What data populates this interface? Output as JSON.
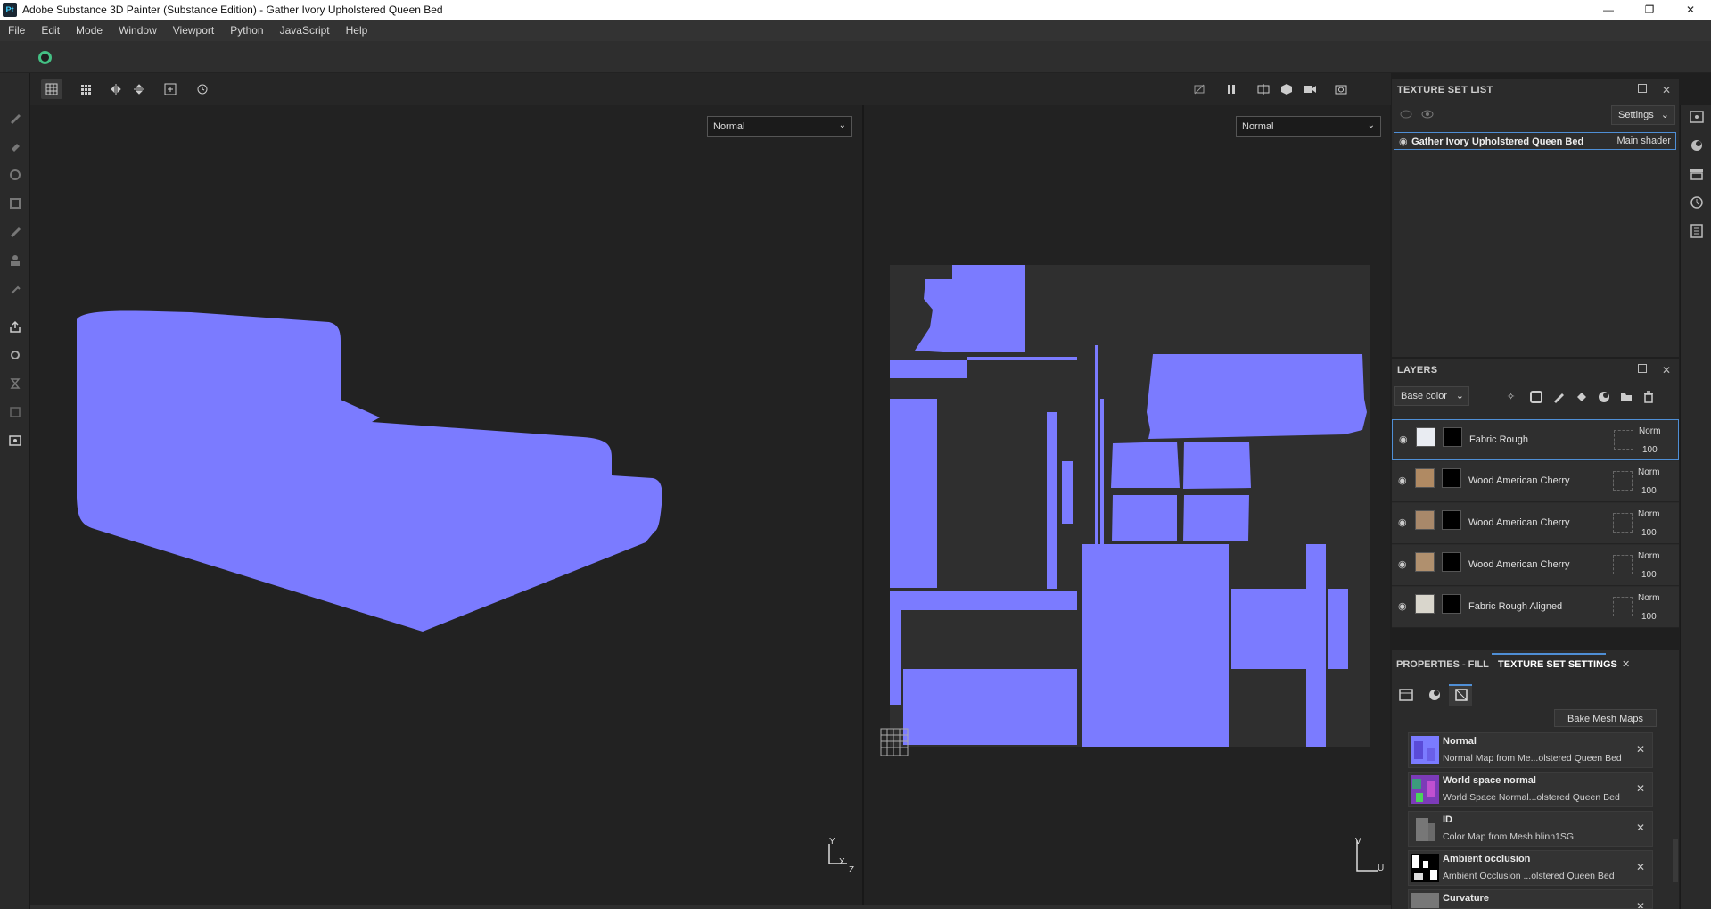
{
  "window": {
    "app_icon": "Pt",
    "title": "Adobe Substance 3D Painter (Substance Edition) - Gather Ivory Upholstered Queen Bed",
    "minimize": "—",
    "restore": "❐",
    "close": "✕"
  },
  "menu": [
    "File",
    "Edit",
    "Mode",
    "Window",
    "Viewport",
    "Python",
    "JavaScript",
    "Help"
  ],
  "viewport": {
    "left_mode": "Normal",
    "right_mode": "Normal",
    "axis_3d": {
      "y": "Y",
      "x": "X",
      "z": "Z"
    },
    "axis_2d": {
      "v": "V",
      "u": "U"
    },
    "uv_color": "#7b7bff"
  },
  "texture_set_list": {
    "title": "TEXTURE SET LIST",
    "settings_label": "Settings",
    "set_name": "Gather Ivory Upholstered Queen Bed",
    "shader": "Main shader"
  },
  "layers": {
    "title": "LAYERS",
    "channel": "Base color",
    "items": [
      {
        "name": "Fabric Rough",
        "blend": "Norm",
        "opacity": "100",
        "thumb": "#e9ecf2",
        "selected": true
      },
      {
        "name": "Wood American Cherry",
        "blend": "Norm",
        "opacity": "100",
        "thumb": "#b08a63",
        "selected": false
      },
      {
        "name": "Wood American Cherry",
        "blend": "Norm",
        "opacity": "100",
        "thumb": "#a8886a",
        "selected": false
      },
      {
        "name": "Wood American Cherry",
        "blend": "Norm",
        "opacity": "100",
        "thumb": "#b0906e",
        "selected": false
      },
      {
        "name": "Fabric Rough Aligned",
        "blend": "Norm",
        "opacity": "100",
        "thumb": "#d9d6cc",
        "selected": false
      }
    ]
  },
  "properties": {
    "tab_fill": "PROPERTIES - FILL",
    "tab_tss": "TEXTURE SET SETTINGS",
    "bake_button": "Bake Mesh Maps",
    "maps": [
      {
        "title": "Normal",
        "subtitle": "Normal Map from Me...olstered Queen Bed"
      },
      {
        "title": "World space normal",
        "subtitle": "World Space Normal...olstered Queen Bed"
      },
      {
        "title": "ID",
        "subtitle": "Color Map from Mesh blinn1SG"
      },
      {
        "title": "Ambient occlusion",
        "subtitle": "Ambient Occlusion ...olstered Queen Bed"
      },
      {
        "title": "Curvature",
        "subtitle": ""
      }
    ]
  }
}
